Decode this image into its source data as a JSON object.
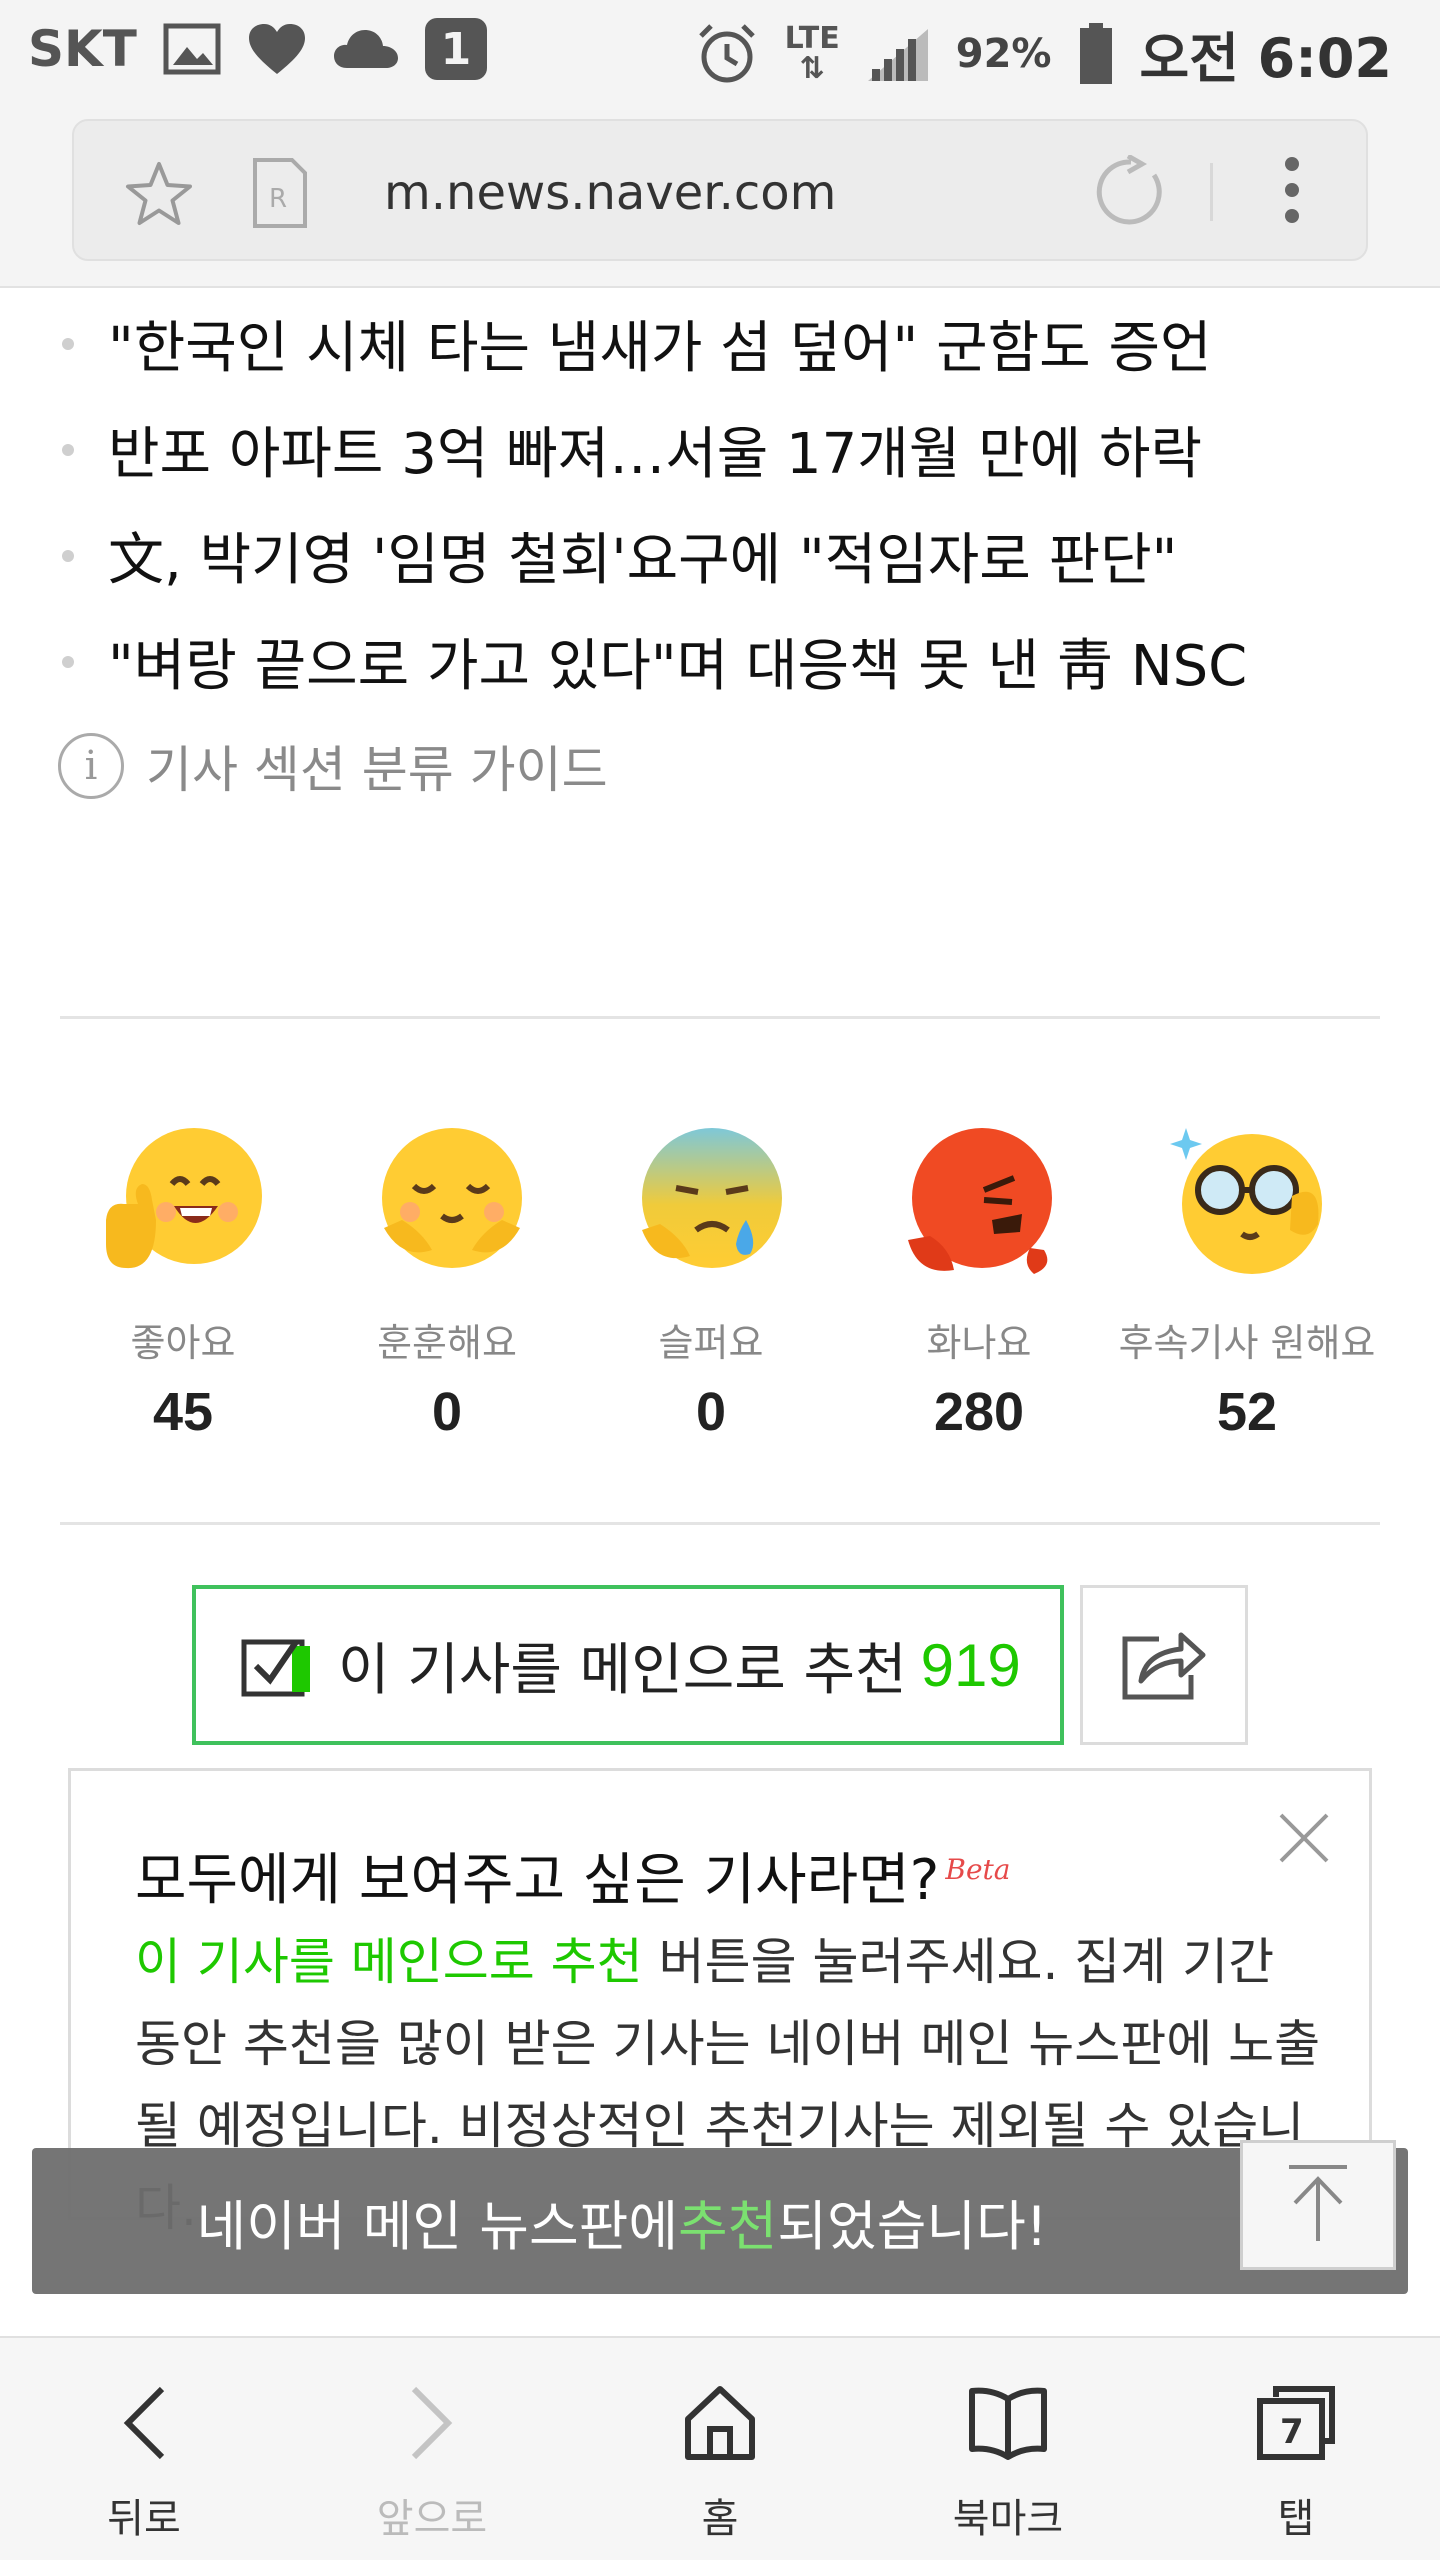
{
  "status_bar": {
    "carrier": "SKT",
    "notification_badge": "1",
    "network_top": "LTE",
    "network_bottom": "⇅",
    "battery": "92%",
    "time": "오전 6:02"
  },
  "url_bar": {
    "url": "m.news.naver.com",
    "reader_icon_letter": "R"
  },
  "headlines": [
    "\"한국인 시체 타는 냄새가 섬 덮어\" 군함도 증언",
    "반포 아파트 3억 빠져…서울 17개월 만에 하락",
    "文, 박기영 '임명 철회'요구에 \"적임자로 판단\"",
    "\"벼랑 끝으로 가고 있다\"며 대응책 못 낸 靑 NSC"
  ],
  "guide": {
    "icon_letter": "i",
    "label": "기사 섹션 분류 가이드"
  },
  "reactions": [
    {
      "label": "좋아요",
      "count": "45",
      "icon": "like-emoji-icon",
      "color": "#ffcc33"
    },
    {
      "label": "훈훈해요",
      "count": "0",
      "icon": "warm-emoji-icon",
      "color": "#ffcc33"
    },
    {
      "label": "슬퍼요",
      "count": "0",
      "icon": "sad-emoji-icon",
      "color": "#8fc6a8"
    },
    {
      "label": "화나요",
      "count": "280",
      "icon": "angry-emoji-icon",
      "color": "#f04a23"
    },
    {
      "label": "후속기사 원해요",
      "count": "52",
      "icon": "want-more-emoji-icon",
      "color": "#ffcc33"
    }
  ],
  "recommend": {
    "label": "이 기사를 메인으로 추천",
    "count": "919",
    "accent_color": "#1ec800"
  },
  "info_box": {
    "title": "모두에게 보여주고 싶은 기사라면?",
    "beta": "Beta",
    "body_highlight": "이 기사를 메인으로 추천",
    "body_text": " 버튼을 눌러주세요. 집계 기간 동안 추천을 많이 받은 기사는 네이버 메인 뉴스판에 노출될 예정입니다. 비정상적인 추천기사는 제외될 수 있습니다."
  },
  "toast": {
    "prefix": "네이버 메인 뉴스판에 ",
    "highlight": "추천",
    "suffix": "되었습니다!"
  },
  "bottom_nav": [
    {
      "label": "뒤로",
      "icon": "back-icon",
      "enabled": true
    },
    {
      "label": "앞으로",
      "icon": "forward-icon",
      "enabled": false
    },
    {
      "label": "홈",
      "icon": "home-icon",
      "enabled": true
    },
    {
      "label": "북마크",
      "icon": "bookmark-icon",
      "enabled": true
    },
    {
      "label": "탭",
      "icon": "tabs-icon",
      "enabled": true,
      "badge": "7"
    }
  ]
}
